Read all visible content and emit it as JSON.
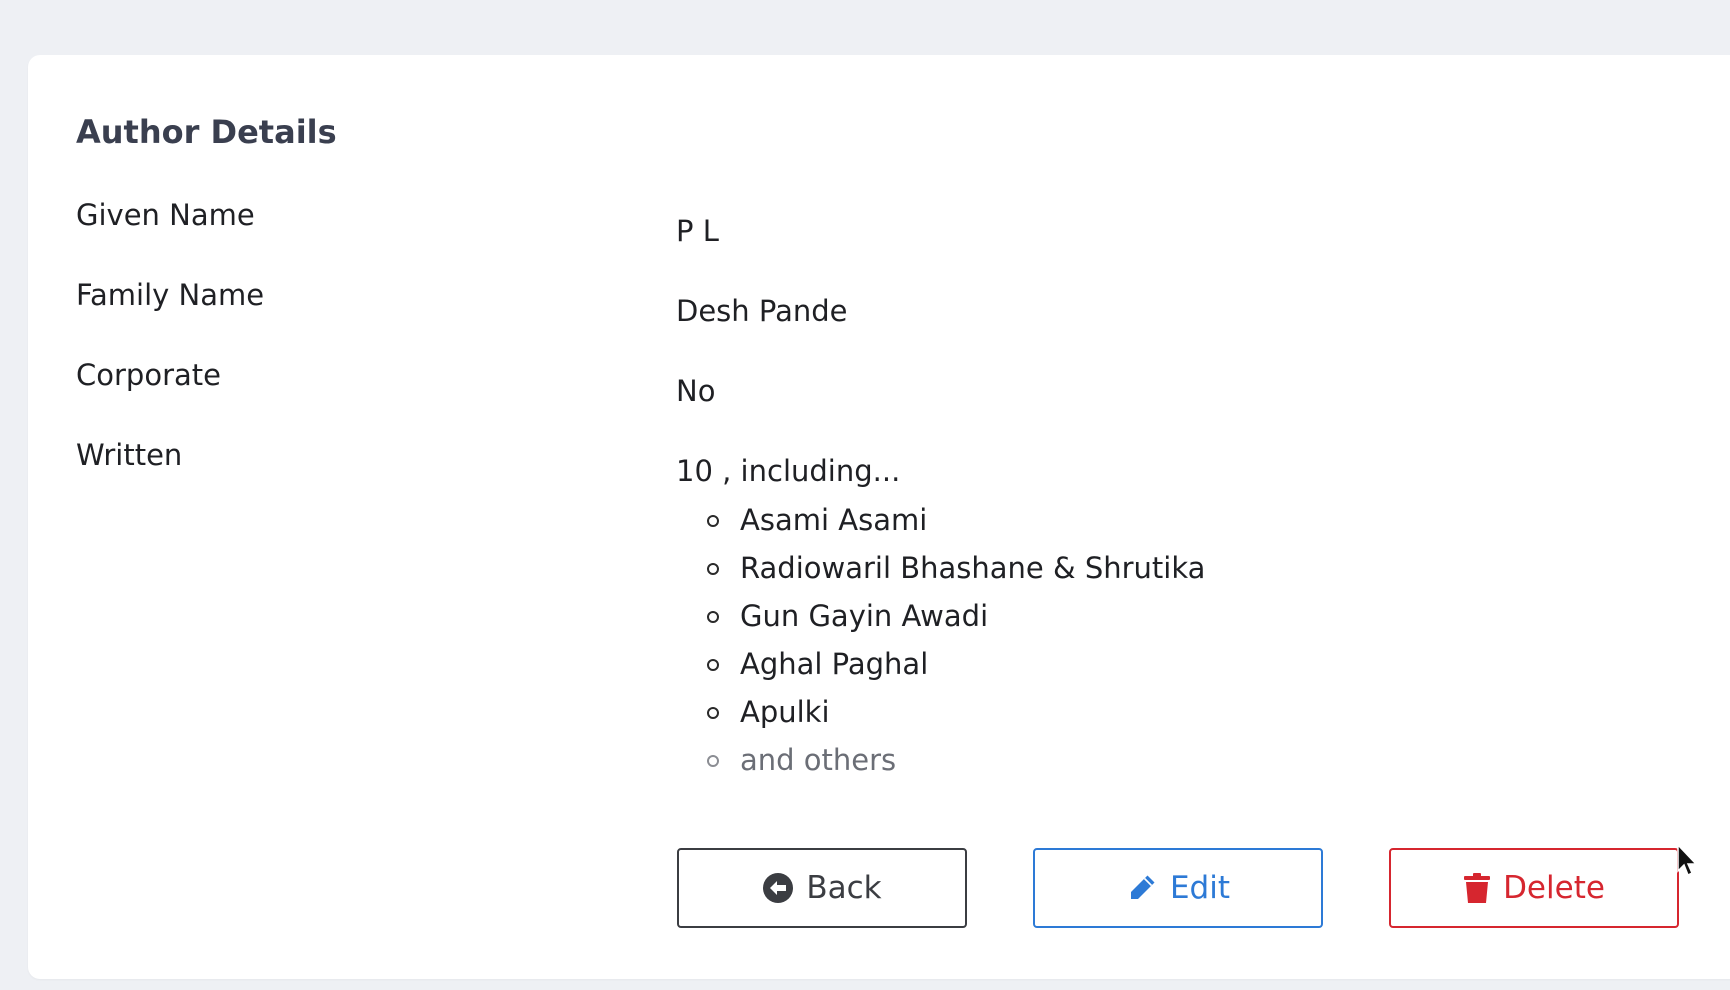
{
  "page": {
    "title": "Author Details"
  },
  "fields": [
    {
      "label": "Given Name",
      "value": "P L"
    },
    {
      "label": "Family Name",
      "value": "Desh Pande"
    },
    {
      "label": "Corporate",
      "value": "No"
    },
    {
      "label": "Written",
      "value": "10 , including..."
    }
  ],
  "written": {
    "books": [
      "Asami Asami",
      "Radiowaril Bhashane & Shrutika",
      "Gun Gayin Awadi",
      "Aghal Paghal",
      "Apulki"
    ],
    "more": "and others"
  },
  "actions": {
    "back": "Back",
    "edit": "Edit",
    "delete": "Delete"
  },
  "icons": {
    "back": "circle-arrow-left-icon",
    "edit": "pencil-icon",
    "delete": "trash-icon"
  },
  "colors": {
    "background": "#eef0f4",
    "card": "#ffffff",
    "edit": "#2d7ad6",
    "delete": "#d6262f",
    "back": "#3b3d42"
  }
}
